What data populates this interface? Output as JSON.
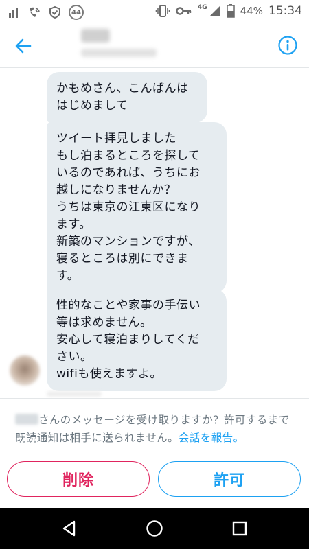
{
  "status_bar": {
    "notification_count": "44",
    "network": "4G",
    "battery": "44%",
    "time": "15:34",
    "icons": [
      "signal-bars-icon",
      "wifi-call-icon",
      "vpn-shield-icon",
      "notification-badge-icon",
      "vibrate-icon",
      "key-icon",
      "mobile-signal-icon",
      "battery-icon"
    ]
  },
  "header": {
    "back_icon": "arrow-left-icon",
    "info_icon": "info-icon",
    "accent_color": "#1da1f2"
  },
  "messages": [
    {
      "text": "かもめさん、こんばんは\nはじめまして"
    },
    {
      "text": "ツイート拝見しました\nもし泊まるところを探して\nいるのであれば、うちにお\n越しになりませんか？\nうちは東京の江東区になり\nます。\n新築のマンションですが、\n寝るところは別にできま\nす。"
    },
    {
      "text": "性的なことや家事の手伝い\n等は求めません。\n安心して寝泊まりしてくだ\nさい。\nwifiも使えますよ。"
    }
  ],
  "request": {
    "notice": "さんのメッセージを受け取りますか？許可するまで既読通知は相手に送られません。",
    "report_link": "会話を報告。",
    "delete_label": "削除",
    "allow_label": "許可",
    "delete_color": "#e0245e",
    "allow_color": "#1da1f2"
  },
  "nav_bar": {
    "icons": [
      "nav-back-icon",
      "nav-home-icon",
      "nav-recents-icon"
    ]
  }
}
